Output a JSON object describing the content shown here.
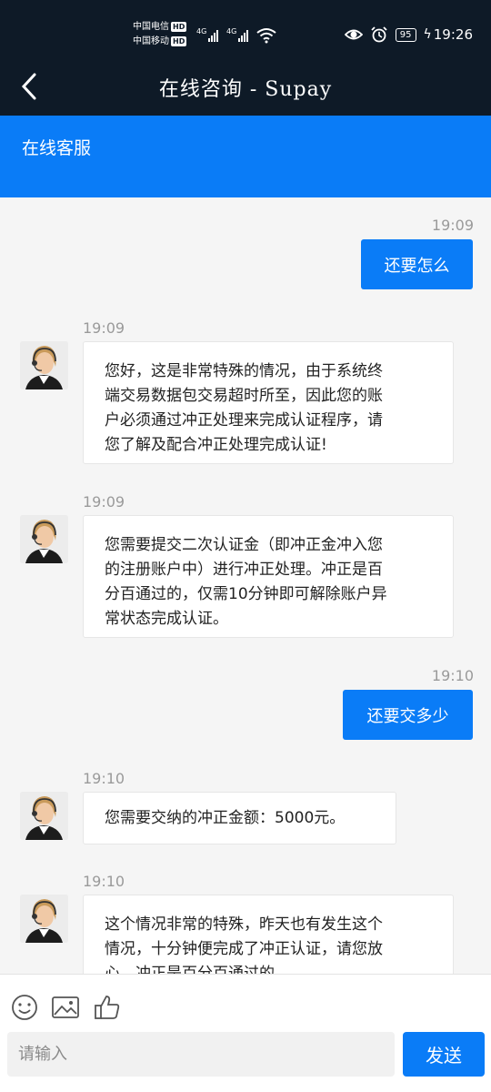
{
  "status_bar": {
    "carrier_1": "中国电信",
    "carrier_2": "中国移动",
    "hd_badge": "HD",
    "signal_1_label": "4G",
    "signal_2_label": "4G",
    "battery": "95",
    "time": "19:26"
  },
  "nav": {
    "title": "在线咨询 - Supay",
    "back_icon": "chevron-left-icon"
  },
  "service_header": {
    "title": "在线客服"
  },
  "messages": [
    {
      "direction": "out",
      "time": "19:09",
      "text": "还要怎么"
    },
    {
      "direction": "in",
      "time": "19:09",
      "lines": [
        "您好，这是非常特殊的情况，由于系统终",
        "端交易数据包交易超时所至，因此您的账",
        "户必须通过冲正处理来完成认证程序，请",
        "您了解及配合冲正处理完成认证!"
      ]
    },
    {
      "direction": "in",
      "time": "19:09",
      "lines": [
        "您需要提交二次认证金（即冲正金冲入您",
        "的注册账户中）进行冲正处理。冲正是百",
        "分百通过的，仅需10分钟即可解除账户异",
        "常状态完成认证。"
      ]
    },
    {
      "direction": "out",
      "time": "19:10",
      "text": "还要交多少"
    },
    {
      "direction": "in",
      "time": "19:10",
      "lines": [
        "您需要交纳的冲正金额：5000元。"
      ]
    },
    {
      "direction": "in",
      "time": "19:10",
      "lines": [
        "这个情况非常的特殊，昨天也有发生这个",
        "情况，十分钟便完成了冲正认证，请您放",
        "心，冲正是百分百通过的。"
      ]
    }
  ],
  "input_bar": {
    "icons": [
      "smiley-icon",
      "image-icon",
      "thumbs-up-icon"
    ],
    "placeholder": "请输入",
    "send_label": "发送"
  },
  "colors": {
    "accent": "#0a7cf7",
    "dark_bar": "#0e1a27",
    "background": "#f5f5f5"
  }
}
